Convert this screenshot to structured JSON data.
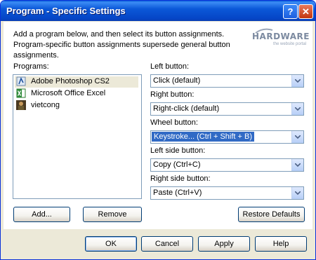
{
  "window": {
    "title": "Program - Specific Settings",
    "help_glyph": "?",
    "close_glyph": "✕"
  },
  "description": "Add a program below, and then select its button assignments. Program-specific button assignments supersede general button assignments.",
  "watermark": {
    "main": "HARDWARE",
    "sub": "the website portal"
  },
  "programs": {
    "label": "Programs:",
    "items": [
      {
        "name": "Adobe Photoshop CS2",
        "icon": "photoshop-icon",
        "selected": true
      },
      {
        "name": "Microsoft Office Excel",
        "icon": "excel-icon",
        "selected": false
      },
      {
        "name": "vietcong",
        "icon": "vietcong-icon",
        "selected": false
      }
    ]
  },
  "assignments": {
    "left": {
      "label": "Left button:",
      "value": "Click (default)"
    },
    "right": {
      "label": "Right button:",
      "value": "Right-click (default)"
    },
    "wheel": {
      "label": "Wheel button:",
      "value": "Keystroke... (Ctrl + Shift + B)"
    },
    "left_side": {
      "label": "Left side button:",
      "value": "Copy (Ctrl+C)"
    },
    "right_side": {
      "label": "Right side button:",
      "value": "Paste (Ctrl+V)"
    }
  },
  "buttons": {
    "add": "Add...",
    "remove": "Remove",
    "restore": "Restore Defaults",
    "ok": "OK",
    "cancel": "Cancel",
    "apply": "Apply",
    "help": "Help"
  },
  "colors": {
    "titlebar": "#0545c6",
    "selection": "#316ac5",
    "dialog_bg": "#ece9d8"
  }
}
